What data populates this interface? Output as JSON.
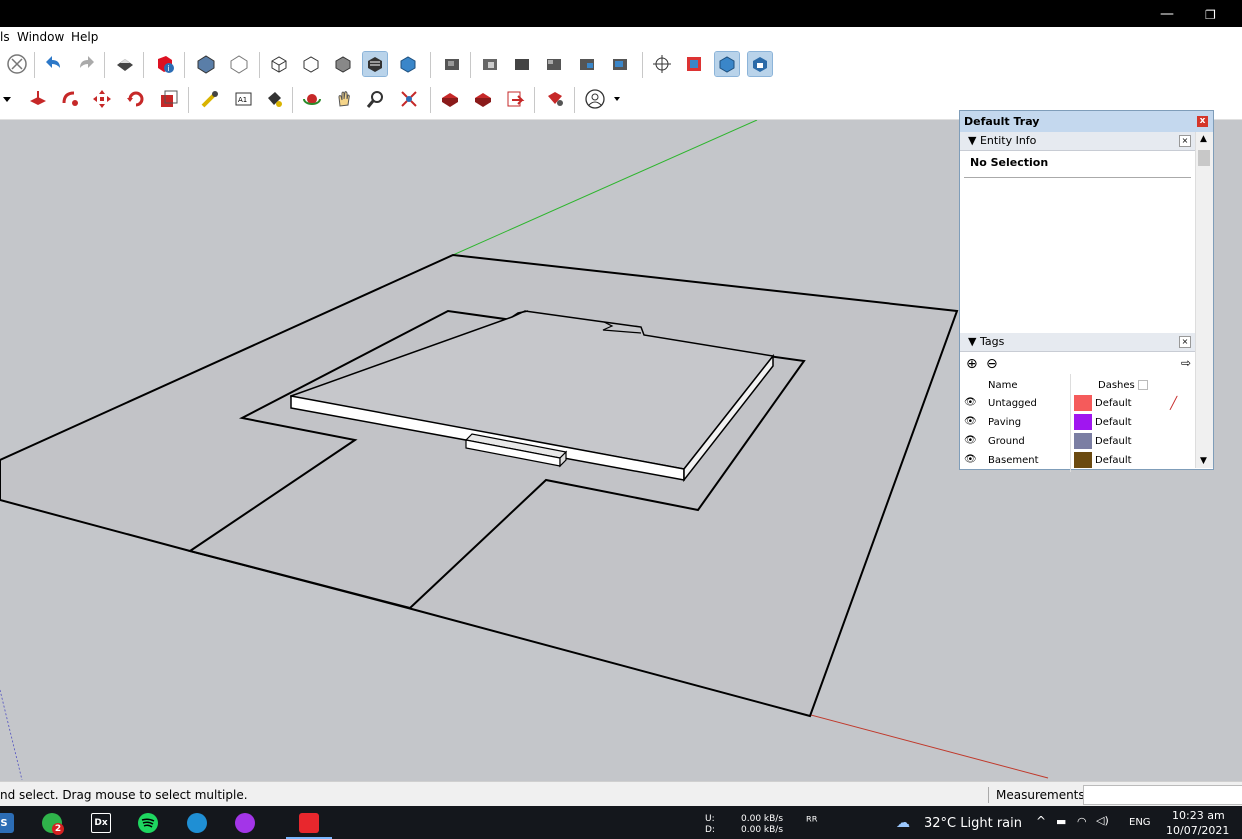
{
  "menu": {
    "tools_partial": "ls",
    "window": "Window",
    "help": "Help"
  },
  "tray": {
    "title": "Default Tray",
    "entity_info": {
      "title": "Entity Info",
      "selection": "No Selection"
    },
    "tags": {
      "title": "Tags",
      "col_name": "Name",
      "col_dashes": "Dashes",
      "rows": [
        {
          "name": "Untagged",
          "color": "#f55b5b",
          "dashes": "Default"
        },
        {
          "name": "Paving",
          "color": "#a016f0",
          "dashes": "Default"
        },
        {
          "name": "Ground",
          "color": "#7b7ea3",
          "dashes": "Default"
        },
        {
          "name": "Basement",
          "color": "#6b4a10",
          "dashes": "Default"
        }
      ]
    }
  },
  "status": {
    "hint": "nd select. Drag mouse to select multiple.",
    "measurements_label": "Measurements"
  },
  "taskbar": {
    "net_up_label": "U:",
    "net_down_label": "D:",
    "net_up": "0.00 kB/s",
    "net_down": "0.00 kB/s",
    "weather": "32°C  Light rain",
    "lang": "ENG",
    "time": "10:23 am",
    "date": "10/07/2021",
    "whatsapp_badge": "2"
  },
  "colors": {
    "accent": "#c4d8ee",
    "axis_green": "#2db52d",
    "axis_red": "#c0392b",
    "sketchup_red": "#e8272d"
  }
}
